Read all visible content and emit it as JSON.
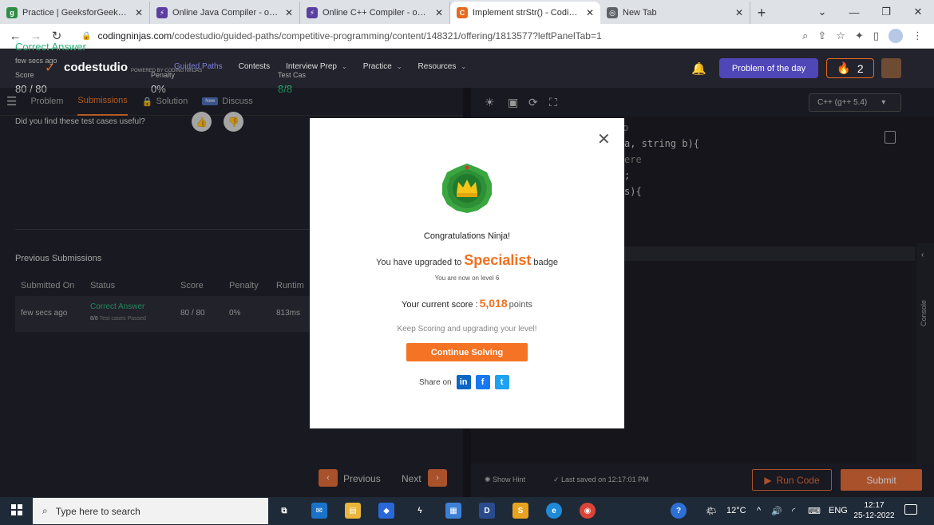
{
  "browser": {
    "tabs": [
      {
        "label": "Practice | GeeksforGeeks | A c",
        "fav_color": "#2f8d46",
        "fav_glyph": "g"
      },
      {
        "label": "Online Java Compiler - online",
        "fav_color": "#5b3fa0",
        "fav_glyph": "⚡"
      },
      {
        "label": "Online C++ Compiler - online",
        "fav_color": "#5b3fa0",
        "fav_glyph": "⚡"
      },
      {
        "label": "Implement strStr() - Coding N",
        "fav_color": "#e66a20",
        "fav_glyph": "C"
      },
      {
        "label": "New Tab",
        "fav_color": "#5f6368",
        "fav_glyph": "◎"
      }
    ],
    "url_domain": "codingninjas.com",
    "url_path": "/codestudio/guided-paths/competitive-programming/content/148321/offering/1813577?leftPanelTab=1"
  },
  "site": {
    "logo_text": "codestudio",
    "logo_sub": "POWERED BY CODING NINJAS",
    "nav": [
      {
        "label": "Guided Paths",
        "active": true,
        "dropdown": false
      },
      {
        "label": "Contests",
        "active": false,
        "dropdown": false
      },
      {
        "label": "Interview Prep",
        "active": false,
        "dropdown": true
      },
      {
        "label": "Practice",
        "active": false,
        "dropdown": true
      },
      {
        "label": "Resources",
        "active": false,
        "dropdown": true
      }
    ],
    "potd_label": "Problem of the day",
    "streak_count": "2"
  },
  "left": {
    "tabs": {
      "problem": "Problem",
      "submissions": "Submissions",
      "solution": "Solution",
      "new_badge": "New",
      "discuss": "Discuss"
    },
    "status": "Correct Answer",
    "time_ago": "few secs ago",
    "score_label": "Score",
    "score_value": "80 / 80",
    "penalty_label": "Penalty",
    "penalty_value": "0%",
    "testcases_label": "Test Cas",
    "testcases_value": "8/8",
    "useful_question": "Did you find these test cases useful?",
    "prev_title": "Previous Submissions",
    "columns": [
      "Submitted On",
      "Status",
      "Score",
      "Penalty",
      "Runtim"
    ],
    "row": {
      "submitted": "few secs ago",
      "status": "Correct Answer",
      "tests": "8/8",
      "tests_note": "Test cases Passed",
      "score": "80 / 80",
      "penalty": "0%",
      "runtime": "813ms"
    },
    "prev_btn": "Previous",
    "next_btn": "Next"
  },
  "editor": {
    "language": "C++ (g++ 5.4)",
    "code_fragments": [
      {
        "text": "o",
        "dim": true
      },
      {
        "text": "a, string b){",
        "dim": false
      },
      {
        "text": "ere",
        "dim": true
      },
      {
        "text": ";",
        "dim": false
      },
      {
        "text": "s){",
        "dim": false
      }
    ],
    "console_label": "Console",
    "show_hint": "Show Hint",
    "last_saved": "Last saved on 12:17:01 PM",
    "run_code": "Run Code",
    "submit": "Submit"
  },
  "modal": {
    "congrats": "Congratulations Ninja!",
    "upgraded_pre": "You have upgraded to",
    "badge_name": "Specialist",
    "upgraded_post": "badge",
    "level_text": "You are now on level 6",
    "score_pre": "Your current score :",
    "score_value": "5,018",
    "score_post": "points",
    "keep_scoring": "Keep Scoring and upgrading your level!",
    "continue_label": "Continue Solving",
    "share_label": "Share on"
  },
  "taskbar": {
    "search_placeholder": "Type here to search",
    "temperature": "12°C",
    "lang": "ENG",
    "time": "12:17",
    "date": "25-12-2022"
  },
  "colors": {
    "accent": "#e66a20",
    "success": "#2bb57a",
    "potd": "#4f46b8"
  }
}
